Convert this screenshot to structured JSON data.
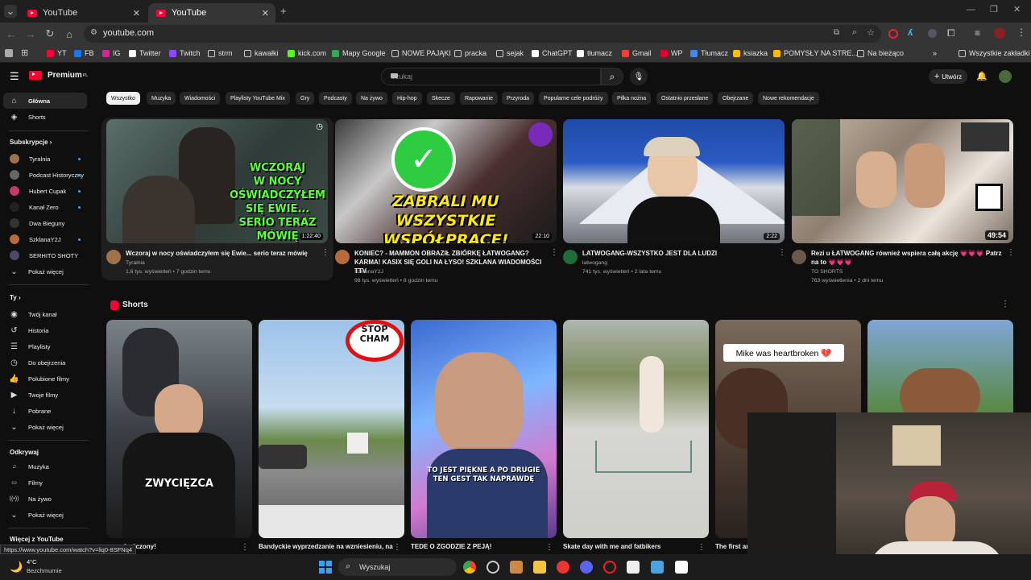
{
  "browser": {
    "tabs": [
      {
        "label": "YouTube",
        "active": false
      },
      {
        "label": "YouTube",
        "active": true
      }
    ],
    "url": "youtube.com",
    "bookmarks": [
      {
        "label": "YT",
        "color": "#ff0033"
      },
      {
        "label": "FB",
        "color": "#1877f2"
      },
      {
        "label": "IG",
        "color": "#d6249f"
      },
      {
        "label": "Twitter",
        "color": "#ffffff"
      },
      {
        "label": "Twitch",
        "color": "#9146ff"
      },
      {
        "label": "strm",
        "color": "folder"
      },
      {
        "label": "kawałki",
        "color": "folder"
      },
      {
        "label": "kick.com",
        "color": "#53fc18"
      },
      {
        "label": "Mapy Google",
        "color": "#34a853"
      },
      {
        "label": "NOWE PAJĄKI",
        "color": "folder"
      },
      {
        "label": "pracka",
        "color": "folder"
      },
      {
        "label": "sejak",
        "color": "folder"
      },
      {
        "label": "ChatGPT",
        "color": "#ffffff"
      },
      {
        "label": "tłumacz",
        "color": "#ffffff"
      },
      {
        "label": "Gmail",
        "color": "#ea4335"
      },
      {
        "label": "WP",
        "color": "#e4002b"
      },
      {
        "label": "Tłumacz",
        "color": "#4285f4"
      },
      {
        "label": "ksiazka",
        "color": "#fbbc05"
      },
      {
        "label": "POMYSŁY NA STRE...",
        "color": "#fbbc05"
      },
      {
        "label": "Na bieżąco",
        "color": "folder"
      }
    ],
    "all_bookmarks": "Wszystkie zakładki",
    "more_bookmarks": "»"
  },
  "header": {
    "logo": "Premium",
    "logo_region": "PL",
    "search_placeholder": "Szukaj",
    "create_label": "Utwórz"
  },
  "sidebar": {
    "main": [
      {
        "label": "Główna",
        "icon": "home-icon"
      },
      {
        "label": "Shorts",
        "icon": "shorts-icon"
      }
    ],
    "subscriptions_title": "Subskrypcje",
    "subscriptions": [
      {
        "label": "Tyralnia",
        "color": "#a0724a"
      },
      {
        "label": "Podcast Historyczny",
        "color": "#666666"
      },
      {
        "label": "Hubert Cupak",
        "color": "#c43a6b"
      },
      {
        "label": "Kanał Zero",
        "color": "#222222"
      },
      {
        "label": "Dwa Bieguny",
        "color": "#333333"
      },
      {
        "label": "SzklanaY2J",
        "color": "#b86a3a"
      },
      {
        "label": "SERHITO SHOTY",
        "color": "#4a4a6a"
      }
    ],
    "show_more_1": "Pokaż więcej",
    "you_title": "Ty",
    "you": [
      {
        "label": "Twój kanał",
        "icon": "channel-icon"
      },
      {
        "label": "Historia",
        "icon": "history-icon"
      },
      {
        "label": "Playlisty",
        "icon": "playlist-icon"
      },
      {
        "label": "Do obejrzenia",
        "icon": "clock-icon"
      },
      {
        "label": "Polubione filmy",
        "icon": "thumb-up-icon"
      },
      {
        "label": "Twoje filmy",
        "icon": "video-icon"
      },
      {
        "label": "Pobrane",
        "icon": "download-icon"
      }
    ],
    "show_more_2": "Pokaż więcej",
    "explore_title": "Odkrywaj",
    "explore": [
      {
        "label": "Muzyka",
        "icon": "music-icon"
      },
      {
        "label": "Filmy",
        "icon": "film-icon"
      },
      {
        "label": "Na żywo",
        "icon": "live-icon"
      }
    ],
    "show_more_3": "Pokaż więcej",
    "more_from": "Więcej z YouTube"
  },
  "chips": [
    "Wszystko",
    "Muzyka",
    "Wiadomości",
    "Playlisty YouTube Mix",
    "Gry",
    "Podcasty",
    "Na żywo",
    "Hip-hop",
    "Skecze",
    "Rapowanie",
    "Przyroda",
    "Popularne cele podróży",
    "Piłka nożna",
    "Ostatnio przesłane",
    "Obejrzane",
    "Nowe rekomendacje"
  ],
  "videos": [
    {
      "title": "Wczoraj w nocy oświadczyłem się Ewie... serio teraz mówię",
      "channel": "Tyralnia",
      "meta": "1,6 tys. wyświetleń • 7 godzin temu",
      "duration": "1:22:40",
      "overlay": "WCZORAJ\nW NOCY\nOŚWIADCZYŁEM\nSIĘ EWIE...\nSERIO TERAZ MÓWIĘ",
      "avatar_color": "#a0724a"
    },
    {
      "title": "KONIEC? - MAMMON OBRAZIŁ ZBIÓRKĘ ŁATWOGANG? KARMA! KASIX SIĘ GOLI NA ŁYSO! SZKLANA WIADOMOŚCI TTV",
      "channel": "SzklanaY2J",
      "meta": "98 tys. wyświetleń • 8 godzin temu",
      "duration": "22:10",
      "overlay": "ZABRALI MU\nWSZYSTKIE WSPÓŁPRACE!",
      "avatar_color": "#b86a3a"
    },
    {
      "title": "LATWOGANG-WSZYSTKO JEST DLA LUDZI",
      "channel": "latwogang",
      "meta": "741 tys. wyświetleń • 2 lata temu",
      "duration": "2:22",
      "overlay": "",
      "avatar_color": "#1f6b3a"
    },
    {
      "title": "Rezi u ŁATWOGANG również wspiera całą akcję 💗💗💗 Patrz na to 💗💗💗",
      "channel": "TO SHORTS",
      "meta": "763 wyświetlenia • 2 dni temu",
      "duration": "49:54",
      "overlay": "",
      "avatar_color": "#6a5a4a"
    }
  ],
  "shorts": {
    "title": "Shorts",
    "items": [
      {
        "title": "...o zakończony!",
        "overlay": "ZWYCIĘZCA"
      },
      {
        "title": "Bandyckie wyprzedzanie na wzniesieniu, na",
        "overlay": "STOP\nCHAM"
      },
      {
        "title": "TEDE O ZGODZIE Z PEJĄ!",
        "overlay": "TO JEST PIĘKNE A PO DRUGIE\nTEN GEST TAK NAPRAWDĘ"
      },
      {
        "title": "Skate day with me and fatbikers",
        "overlay": ""
      },
      {
        "title": "The first an",
        "overlay": "Mike was heartbroken 💔"
      },
      {
        "title": "",
        "overlay": ""
      }
    ]
  },
  "status_url": "https://www.youtube.com/watch?v=liq0-8SFNq4",
  "taskbar": {
    "weather_temp": "4°C",
    "weather_desc": "Bezchmurnie",
    "search_label": "Wyszukaj"
  }
}
